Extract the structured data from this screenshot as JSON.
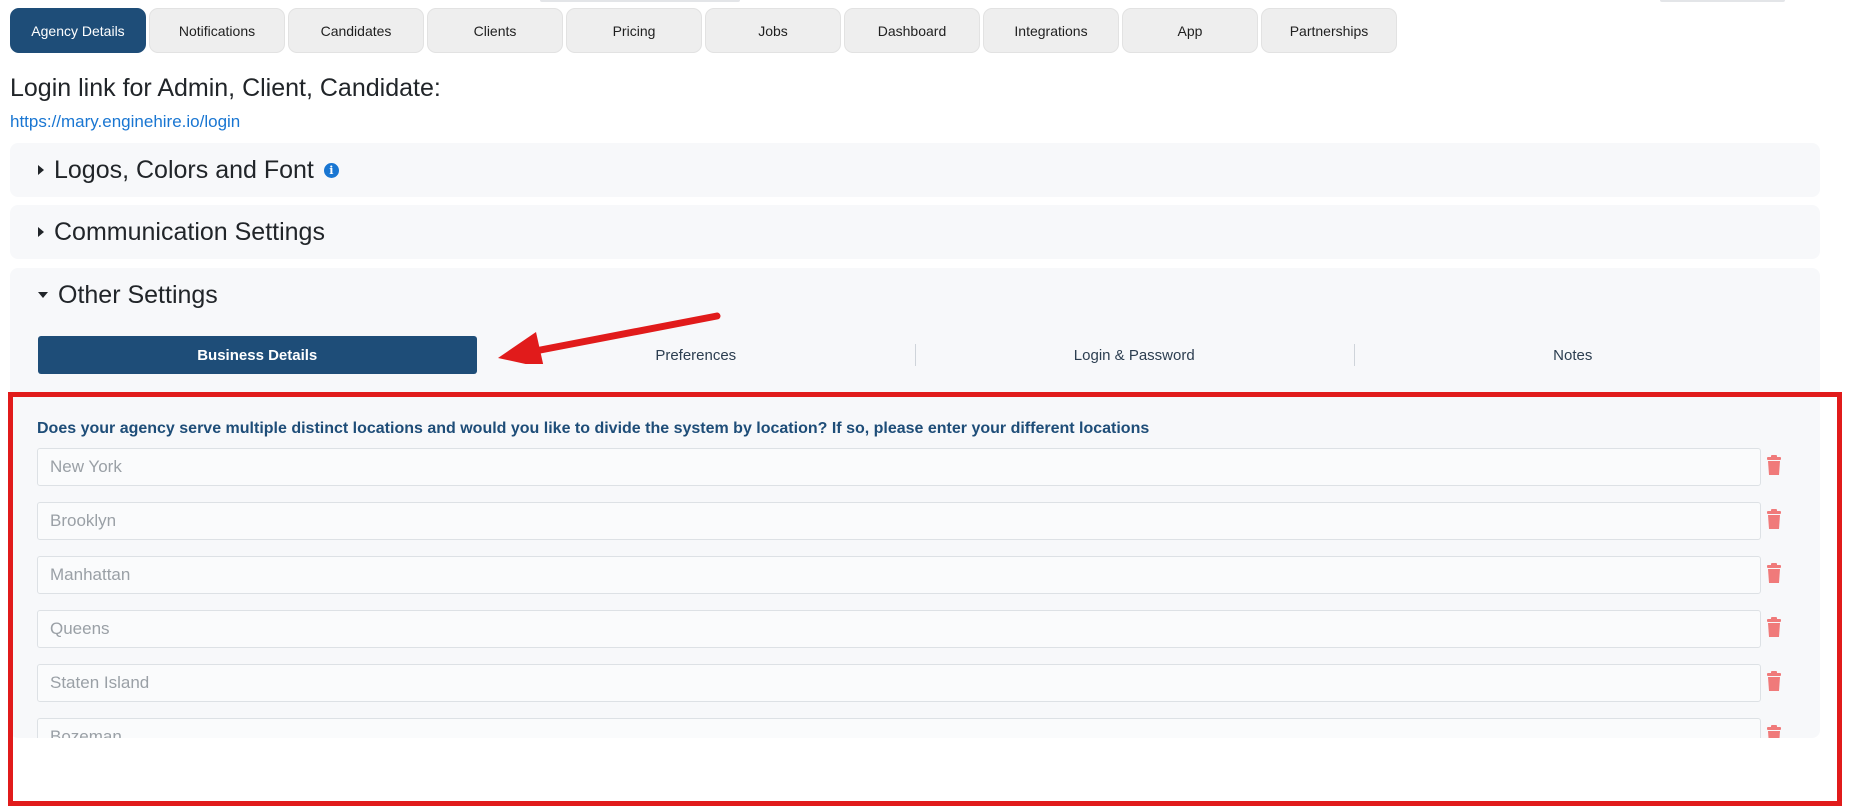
{
  "tabs": [
    {
      "label": "Agency Details",
      "active": true
    },
    {
      "label": "Notifications",
      "active": false
    },
    {
      "label": "Candidates",
      "active": false
    },
    {
      "label": "Clients",
      "active": false
    },
    {
      "label": "Pricing",
      "active": false
    },
    {
      "label": "Jobs",
      "active": false
    },
    {
      "label": "Dashboard",
      "active": false
    },
    {
      "label": "Integrations",
      "active": false
    },
    {
      "label": "App",
      "active": false
    },
    {
      "label": "Partnerships",
      "active": false
    }
  ],
  "login": {
    "title": "Login link for Admin, Client, Candidate:",
    "url": "https://mary.enginehire.io/login"
  },
  "accordions": {
    "logos": {
      "title": "Logos, Colors and Font",
      "expanded": false,
      "icon": "info-icon"
    },
    "communication": {
      "title": "Communication Settings",
      "expanded": false
    },
    "other": {
      "title": "Other Settings",
      "expanded": true
    }
  },
  "subtabs": [
    {
      "label": "Business Details",
      "active": true
    },
    {
      "label": "Preferences",
      "active": false
    },
    {
      "label": "Login & Password",
      "active": false
    },
    {
      "label": "Notes",
      "active": false
    }
  ],
  "business_details": {
    "question": "Does your agency serve multiple distinct locations and would you like to divide the system by location? If so, please enter your different locations",
    "locations": [
      "New York",
      "Brooklyn",
      "Manhattan",
      "Queens",
      "Staten Island",
      "Bozeman"
    ],
    "delete_icon": "trash-icon"
  },
  "colors": {
    "primary": "#1e4d78",
    "link": "#1976d2",
    "delete": "#f07a7a",
    "annotation": "#e11b1b"
  }
}
